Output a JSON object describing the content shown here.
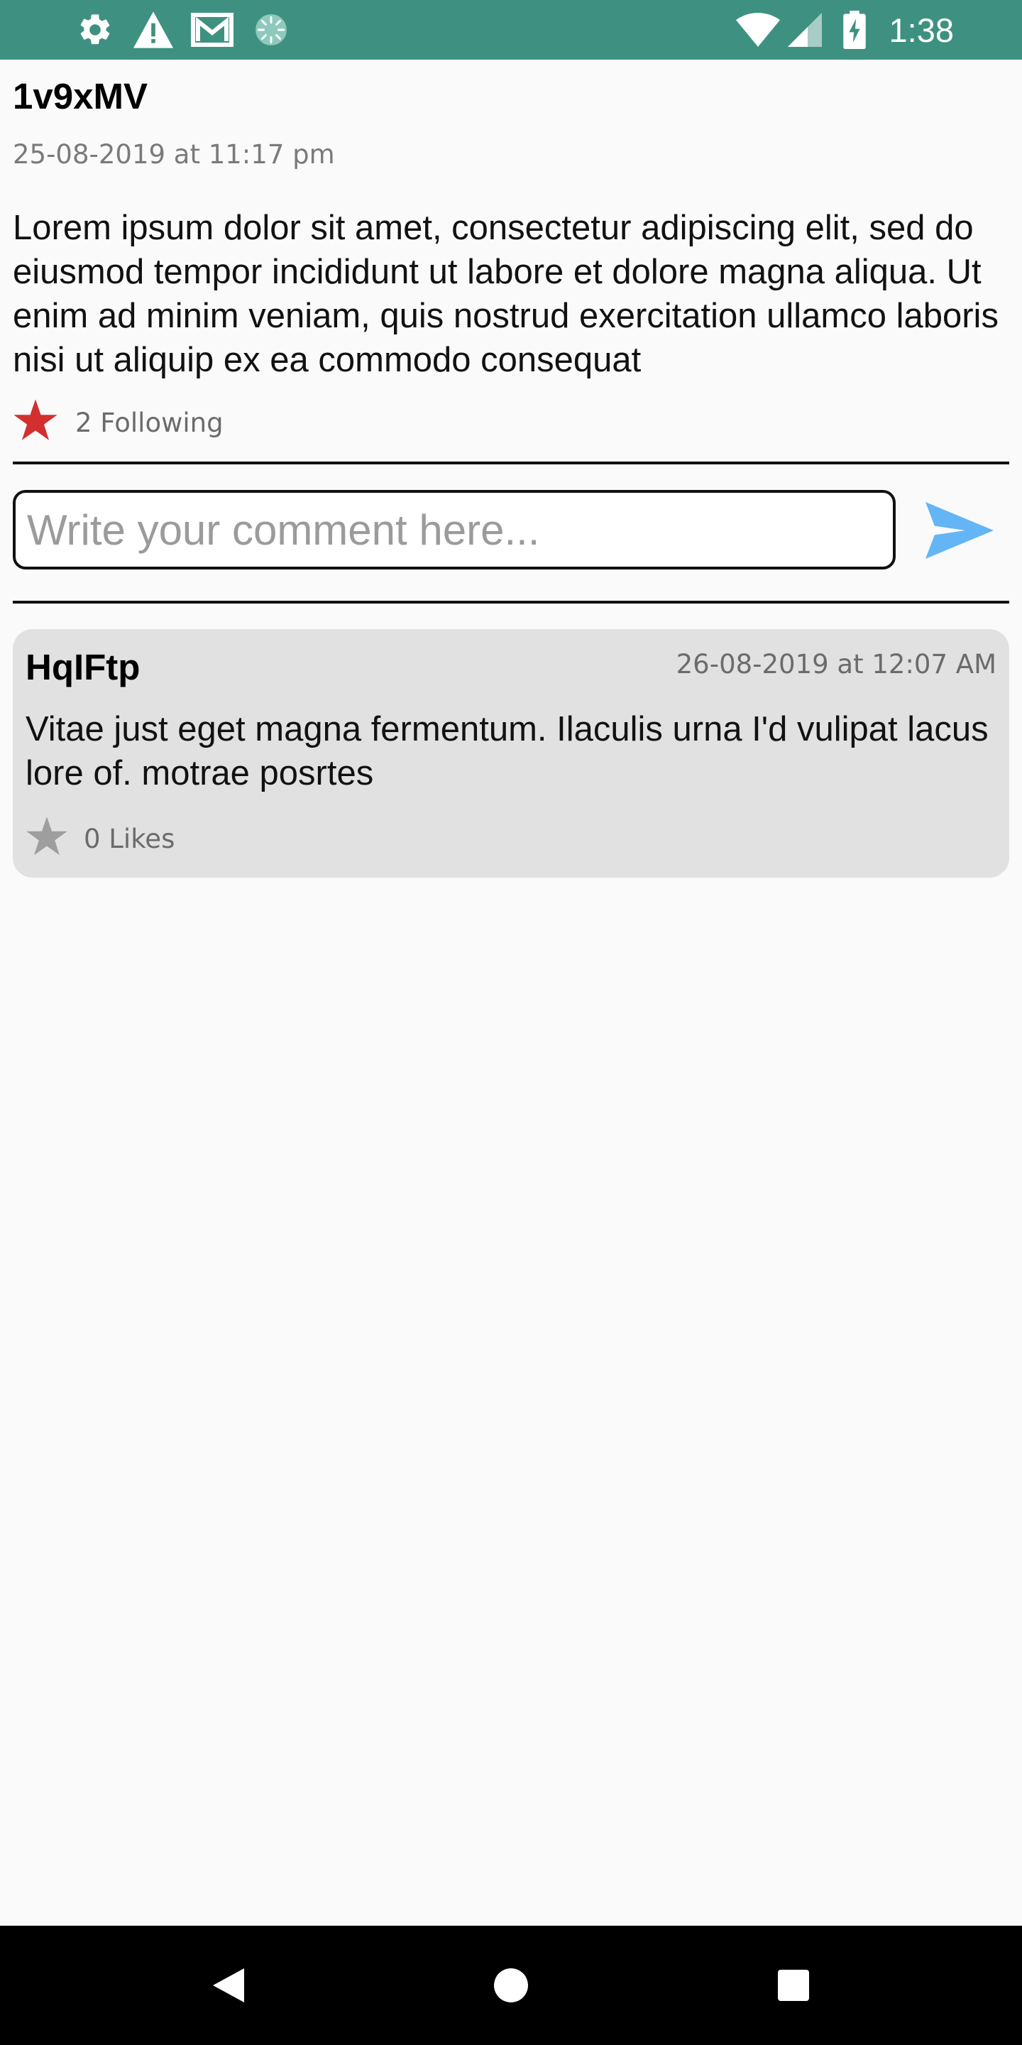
{
  "status_bar": {
    "time": "1:38",
    "icons": [
      "gear-icon",
      "warning-icon",
      "gmail-icon",
      "sync-icon",
      "wifi-icon",
      "signal-icon",
      "battery-icon"
    ],
    "background": "#3e9180"
  },
  "post": {
    "author": "1v9xMV",
    "timestamp": "25-08-2019 at 11:17 pm",
    "body": "Lorem ipsum dolor sit amet, consectetur adipiscing elit, sed do eiusmod tempor incididunt ut labore et dolore magna aliqua. Ut enim ad minim veniam, quis nostrud exercitation ullamco laboris nisi ut aliquip ex ea commodo consequat",
    "following_label": "2 Following",
    "star_color": "#d32f2f"
  },
  "comment_box": {
    "placeholder": "Write your comment here...",
    "value": "",
    "send_icon": "send-icon",
    "send_color": "#64b5f6"
  },
  "comments": [
    {
      "author": "HqIFtp",
      "timestamp": "26-08-2019 at 12:07 AM",
      "text": "Vitae just eget magna fermentum. Ilaculis urna I'd vulipat lacus lore of. motrae posrtes",
      "likes_label": "0 Likes",
      "star_color": "#9e9e9e"
    }
  ],
  "nav_bar": {
    "icons": [
      "back-icon",
      "home-icon",
      "recents-icon"
    ]
  }
}
